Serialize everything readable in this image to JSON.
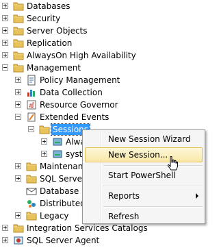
{
  "tree": [
    {
      "label": "Databases",
      "icon": "folder-icon",
      "expander": "plus",
      "level": 0
    },
    {
      "label": "Security",
      "icon": "folder-icon",
      "expander": "plus",
      "level": 0
    },
    {
      "label": "Server Objects",
      "icon": "folder-icon",
      "expander": "plus",
      "level": 0
    },
    {
      "label": "Replication",
      "icon": "folder-icon",
      "expander": "plus",
      "level": 0
    },
    {
      "label": "AlwaysOn High Availability",
      "icon": "folder-icon",
      "expander": "plus",
      "level": 0
    },
    {
      "label": "Management",
      "icon": "folder-icon",
      "expander": "minus",
      "level": 0
    },
    {
      "label": "Policy Management",
      "icon": "policy-management-icon",
      "expander": "plus",
      "level": 1
    },
    {
      "label": "Data Collection",
      "icon": "data-collection-icon",
      "expander": "plus",
      "level": 1
    },
    {
      "label": "Resource Governor",
      "icon": "resource-governor-icon",
      "expander": "plus",
      "level": 1
    },
    {
      "label": "Extended Events",
      "icon": "extended-events-icon",
      "expander": "minus",
      "level": 1
    },
    {
      "label": "Sessions",
      "icon": "folder-icon",
      "expander": "minus",
      "level": 2,
      "selected": true
    },
    {
      "label": "Alwa",
      "icon": "session-icon",
      "expander": "plus",
      "level": 3
    },
    {
      "label": "syste",
      "icon": "session-icon",
      "expander": "plus",
      "level": 3
    },
    {
      "label": "Maintenanc",
      "icon": "folder-icon",
      "expander": "plus",
      "level": 1
    },
    {
      "label": "SQL Server L",
      "icon": "folder-icon",
      "expander": "plus",
      "level": 1
    },
    {
      "label": "Database M",
      "icon": "database-mail-icon",
      "expander": "none",
      "level": 1
    },
    {
      "label": "Distributed T",
      "icon": "distributed-transaction-icon",
      "expander": "none",
      "level": 1
    },
    {
      "label": "Legacy",
      "icon": "folder-icon",
      "expander": "plus",
      "level": 1
    },
    {
      "label": "Integration Services Catalogs",
      "icon": "folder-icon",
      "expander": "plus",
      "level": 0
    },
    {
      "label": "SQL Server Agent",
      "icon": "sql-server-agent-icon",
      "expander": "plus",
      "level": 0
    }
  ],
  "context_menu": {
    "items": [
      {
        "label": "New Session Wizard",
        "type": "item"
      },
      {
        "label": "New Session...",
        "type": "item",
        "hover": true
      },
      {
        "type": "separator"
      },
      {
        "label": "Start PowerShell",
        "type": "item"
      },
      {
        "type": "separator"
      },
      {
        "label": "Reports",
        "type": "submenu"
      },
      {
        "type": "separator"
      },
      {
        "label": "Refresh",
        "type": "item"
      }
    ]
  },
  "colors": {
    "folder": "#e8c25a",
    "selection": "#3399ff",
    "menu_hover": "#f8e8a6"
  }
}
